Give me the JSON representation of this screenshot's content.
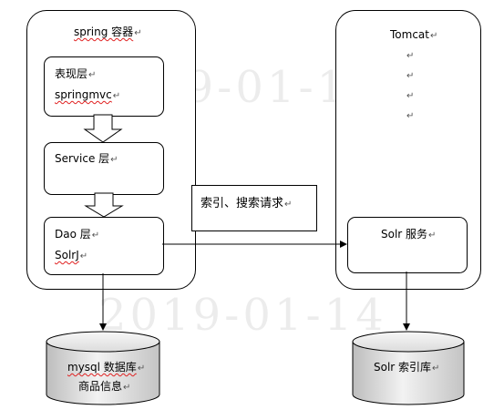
{
  "spring_container": {
    "title": "spring 容器"
  },
  "layer_view": {
    "line1": "表现层",
    "line2": "springmvc"
  },
  "layer_service": {
    "label": "Service 层"
  },
  "layer_dao": {
    "line1": "Dao 层",
    "line2": "SolrJ"
  },
  "tomcat": {
    "title": "Tomcat",
    "dots": [
      "",
      "",
      "",
      ""
    ]
  },
  "solr_service": {
    "label": "Solr 服务"
  },
  "request_label": "索引、搜索请求",
  "db_mysql": {
    "line1": "mysql 数据库",
    "line2": "商品信息"
  },
  "db_solr": {
    "label": "Solr 索引库"
  },
  "watermark": {
    "text": "2019-01-14"
  },
  "return_mark": "↵"
}
